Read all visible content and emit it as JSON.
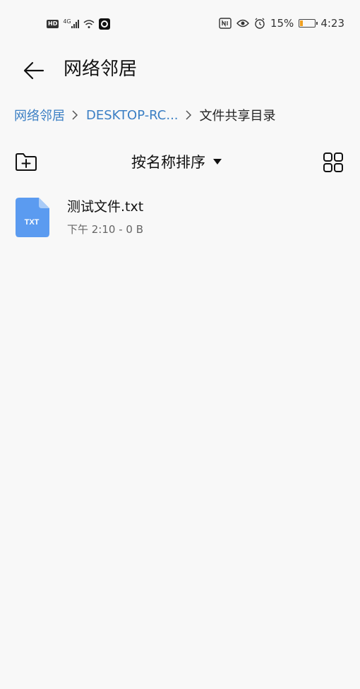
{
  "status_bar": {
    "left_badges": {
      "hd": "HD",
      "network": "4G"
    },
    "battery_percent": "15%",
    "battery_level": 0.15,
    "time": "4:23"
  },
  "app_bar": {
    "title": "网络邻居"
  },
  "breadcrumb": {
    "items": [
      "网络邻居",
      "DESKTOP-RC...",
      "文件共享目录"
    ]
  },
  "toolbar": {
    "sort_label": "按名称排序"
  },
  "files": [
    {
      "name": "测试文件.txt",
      "icon_label": "TXT",
      "time": "下午 2:10",
      "separator": " - ",
      "size": "0 B"
    }
  ],
  "colors": {
    "accent": "#3b7fc4",
    "file_icon": "#5b9bf0",
    "background": "#f8f8f8"
  },
  "icons": [
    "back-arrow-icon",
    "chevron-right-icon",
    "new-folder-icon",
    "triangle-down-icon",
    "grid-view-icon",
    "txt-file-icon",
    "eye-icon",
    "alarm-icon",
    "battery-icon",
    "wifi-icon",
    "signal-icon"
  ]
}
